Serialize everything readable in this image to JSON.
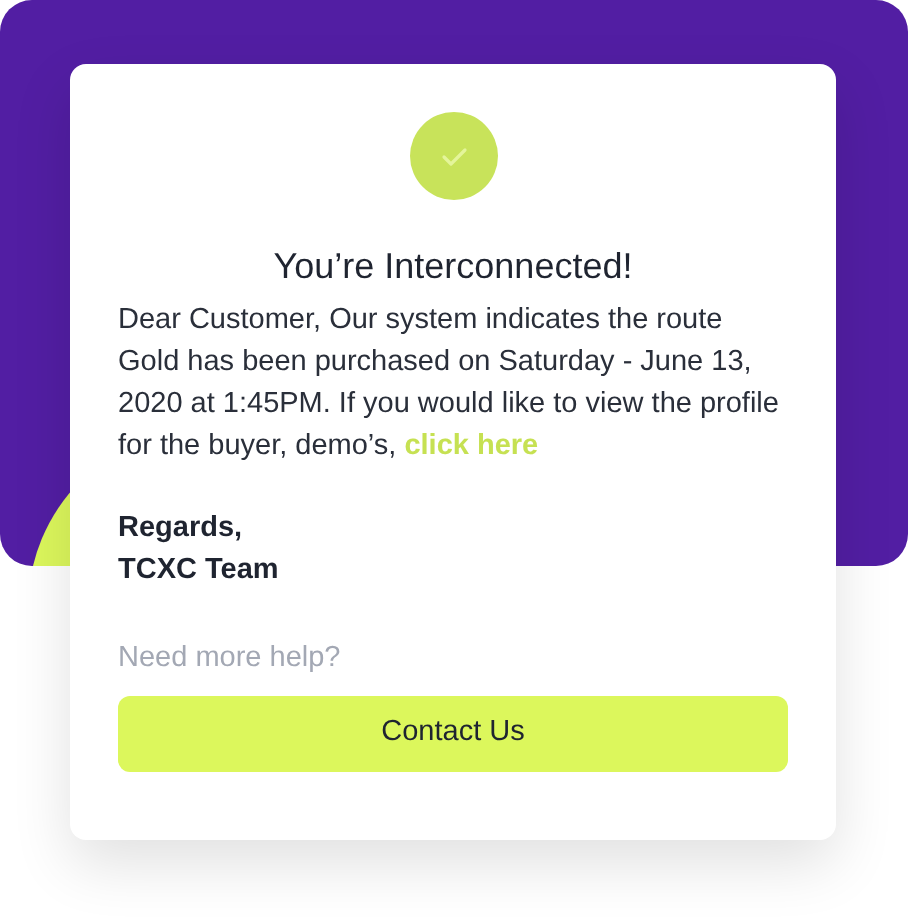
{
  "title": "You’re Interconnected!",
  "message": {
    "text": "Dear Customer, Our system indicates the route Gold has been purchased on Saturday - June 13, 2020 at 1:45PM. If you would like to view the profile for the buyer, demo’s,",
    "link": "click here"
  },
  "signature": [
    "Regards,",
    "TCXC Team"
  ],
  "help_text": "Need more help?",
  "button": "Contact Us"
}
